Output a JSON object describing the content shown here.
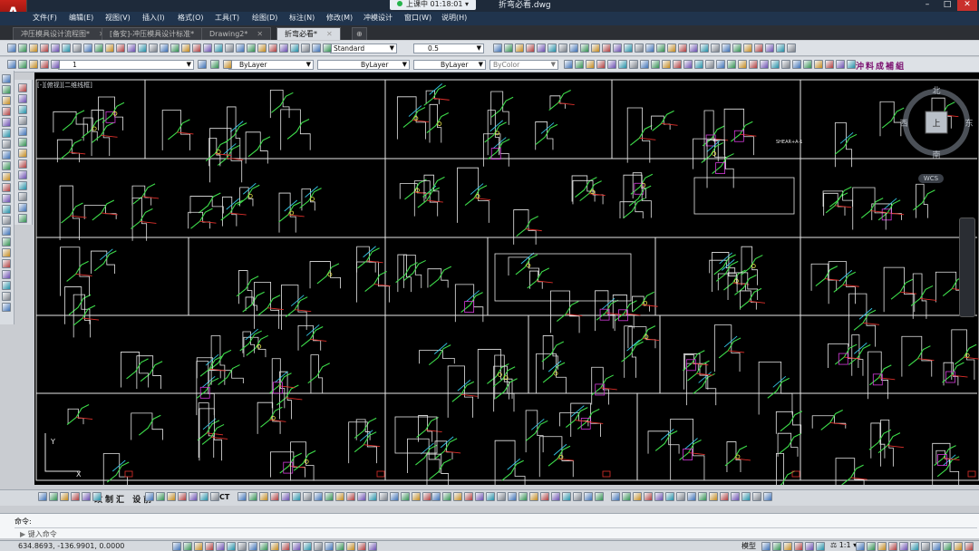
{
  "titlebar": {
    "recording": "上课中 01:18:01",
    "document": "折弯必看.dwg"
  },
  "menu": [
    "文件(F)",
    "编辑(E)",
    "视图(V)",
    "插入(I)",
    "格式(O)",
    "工具(T)",
    "绘图(D)",
    "标注(N)",
    "修改(M)",
    "冲模设计",
    "窗口(W)",
    "说明(H)"
  ],
  "tabs": [
    {
      "label": "冲压模具设计流程图*",
      "active": false
    },
    {
      "label": "[备安]-冲压模具设计标准*",
      "active": false
    },
    {
      "label": "Drawing2*",
      "active": false
    },
    {
      "label": "折弯必看*",
      "active": true
    }
  ],
  "toolbar": {
    "text_style": "Standard",
    "lineweight_value": "0.5",
    "layer_name": "1",
    "color": "ByLayer",
    "linetype": "ByLayer",
    "lineweight": "ByLayer",
    "plot_style": "ByColor",
    "custom_tools": [
      "改",
      "制",
      "汇",
      "设",
      "前",
      "CT"
    ],
    "custom_chars": [
      "沖",
      "料",
      "成",
      "補",
      "組"
    ]
  },
  "canvas": {
    "viewport_label": "[-][俯视][二维线框]",
    "bg": "#000000",
    "compass": {
      "n": "北",
      "s": "南",
      "e": "东",
      "w": "西",
      "center": "上"
    },
    "wcs": "WCS",
    "sketch_label": "SHEAR+A-1"
  },
  "command": {
    "label": "命令:",
    "prompt": "键入命令"
  },
  "status": {
    "coords": "634.8693,  -136.9901, 0.0000",
    "model": "模型",
    "scale": "1:1"
  },
  "colors": {
    "accent": "#c7221a",
    "titlebar": "#1e2a3a",
    "menubar": "#20344d",
    "frame": "#e6e6e6"
  },
  "icons": [
    "zoom-icon",
    "pan-icon",
    "save-icon",
    "open-icon",
    "print-icon",
    "undo-icon",
    "redo-icon",
    "layer-icon",
    "match-properties-icon"
  ]
}
